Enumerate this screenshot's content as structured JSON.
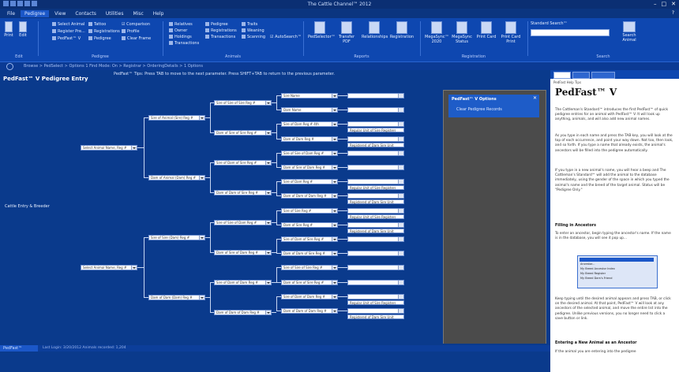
{
  "window": {
    "title": "The Cattle Channel™ 2012",
    "controls": [
      "–",
      "□",
      "✕"
    ]
  },
  "menu": {
    "items": [
      "File",
      "Pedigree",
      "View",
      "Contacts",
      "Utilities",
      "Misc",
      "Help"
    ],
    "active_index": 1,
    "help_label": "?"
  },
  "ribbon": {
    "group1": {
      "buttons": [
        "Print",
        "Edit"
      ],
      "label": "Edit"
    },
    "group2": {
      "col1": [
        "Select Animal",
        "Register Pre...",
        "PedFast™ V"
      ],
      "col2": [
        "Tattoo",
        "Registrations",
        "Pedigree"
      ],
      "col3": [
        "☑ Comparison",
        "Profile",
        "Clear Frame"
      ],
      "label": "Pedigree"
    },
    "group3": {
      "col1": [
        "Relatives",
        "Owner",
        "Holdings",
        "Transactions"
      ],
      "col2": [
        "Pedigree",
        "Registrations",
        "Transactions"
      ],
      "col3": [
        "Traits",
        "Weaning",
        "Scanning"
      ],
      "check": "☑ AutoSearch™",
      "label": "Animals"
    },
    "group4": {
      "buttons": [
        "PedSelector™",
        "Transfer PDF",
        "Relationships",
        "Registration"
      ],
      "label": "Reports"
    },
    "group5": {
      "buttons": [
        "MegaSync™ 2020",
        "MegaSync Status",
        "Print Card",
        "Print Card Print"
      ],
      "label": "Registration"
    },
    "search": {
      "label": "Standard Search™",
      "value": "",
      "placeholder": "",
      "button": "Search Animal",
      "group_label": "Search"
    }
  },
  "subbar": {
    "text": "Browse > PedSelect > Options 1 Find Mode: On > Registrar > OrderingDetails > 1 Options"
  },
  "page": {
    "heading": "PedFast™ V Pedigree Entry",
    "hint": "PedFast™ Tips: Press TAB to move to the next parameter. Press SHIFT+TAB to return to the previous parameter.",
    "reference_label": "Cattle Entry & Breeder"
  },
  "pedigree": {
    "gen1": [
      "Select Animal Name, Reg #",
      "Select Animal Name, Reg #"
    ],
    "gen2": [
      "Sire of Animal (Sire) Reg #",
      "Dam of Animal (Dam) Reg #",
      "Sire of Sire (Dam) Reg #",
      "Dam of Dam (Dam) Reg #"
    ],
    "gen3": [
      "Sire of Sire of Sire Reg #",
      "Dam of Sire of Sire Reg #",
      "Sire of Dam of Sire Reg #",
      "Dam of Dam of Sire Reg #",
      "Sire of Sire of Dam Reg #",
      "Dam of Sire of Dam Reg #",
      "Sire of Dam of Dam Reg #",
      "Dam of Dam of Dam Reg #"
    ],
    "gen4": [
      "Sire Name",
      "Dam Name",
      "Sire of Dam Reg # 4th",
      "Dam of Dam Reg #",
      "Sire of Sire of Dam Reg #",
      "Dam of Sire of Dam Reg #",
      "Sire of Dam Reg #",
      "Dam of Dam of Dam Reg #",
      "Sire of Sire Reg #",
      "Dam of Sire Reg #",
      "Sire of Dam of Sire Reg #",
      "Dam of Dam of Sire Reg #",
      "Sire of Sire of Sire Reg #",
      "Dam of Sire of Sire Reg #",
      "Sire of Dam of Dam Reg #",
      "Dam of Dam of Dam Reg #"
    ],
    "gen5_notes": [
      "Regular Unit of Sire Registered",
      "Registered of Dam Sire Unit",
      "Regular Unit of Sire Registered",
      "Registered of Dam Sire Unit",
      "Regular Unit of Sire Registered",
      "Registered of Dam Sire Unit",
      "Regular Unit of Sire Registered",
      "Registered of Dam Sire Unit"
    ]
  },
  "options_panel": {
    "title": "PedFast™ V Options",
    "close": "✕",
    "link": "Clear Pedigree Records"
  },
  "help_panel": {
    "topic": "PedFast Help Tips",
    "title": "PedFast™ V",
    "paragraphs": [
      "The Cattleman's Standard™ introduces the first PedFast™ of quick pedigree entries for an animal with PedFast™ V. It will look up anything, animals, and will also add new animal names.",
      "As you type in each name and press the TAB key, you will look at the top of each occurrence, and point your way down. Not too, then look, and so forth. If you type a name that already exists, the animal's ancestors will be filled into the pedigree automatically.",
      "If you type in a new animal's name, you will hear a beep and The Cattleman's Standard™ will add the animal to the database immediately, using the gender of the space in which you typed the animal's name and the breed of the target animal. Status will be \"Pedigree Only.\""
    ],
    "sub1": "Filling in Ancestors",
    "para4": "To enter an ancestor, begin typing the ancestor's name. If the name is in the database, you will see it pop up...",
    "shot_rows": [
      "Ancestor...",
      "My Breed Ancestor Index",
      "My Breed Register",
      "My Breed Dam's Friend"
    ],
    "para5": "Keep typing until the desired animal appears and press TAB, or click on the desired animal. At that point, PedFast™ V will look at any ancestors of the selected animal, and move the entire list into the pedigree. Unlike previous versions, you no longer need to click a save button or link.",
    "sub2": "Entering a New Animal as an Ancestor",
    "para6": "If the animal you are entering into the pedigree"
  },
  "statusbar": {
    "tab": "PedFast™",
    "text": "Last Login: 3/20/2012 Animals recorded: 1,204"
  }
}
